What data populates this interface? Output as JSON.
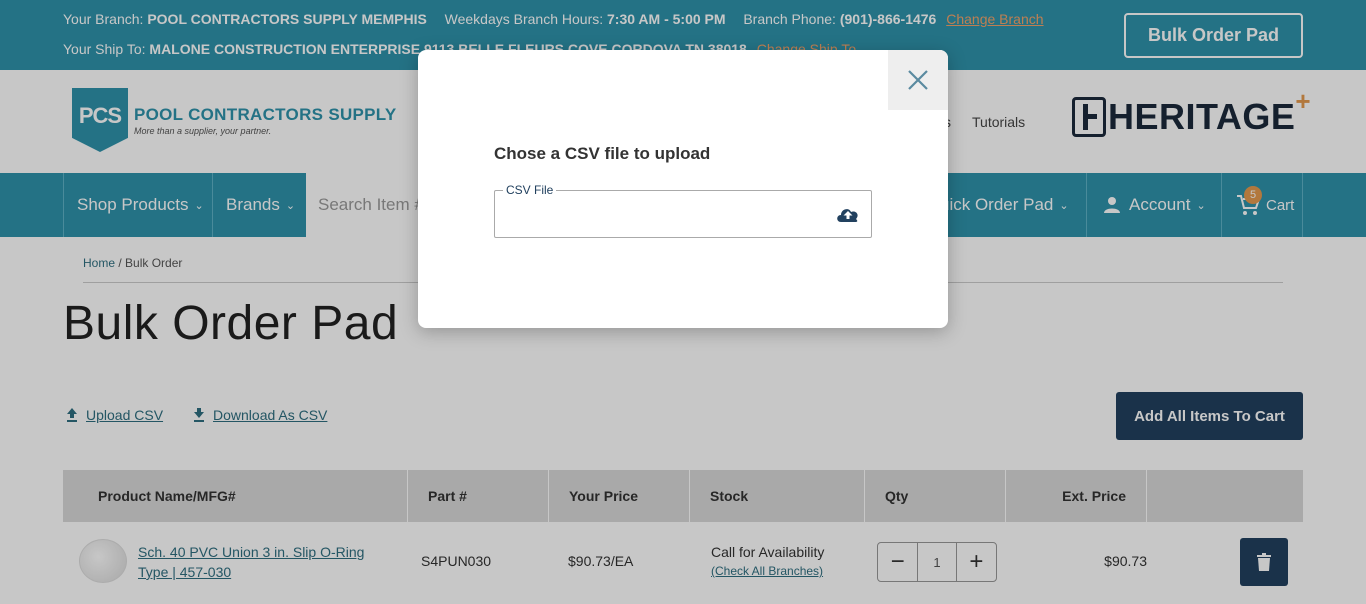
{
  "topbar": {
    "branch_label": "Your Branch:",
    "branch_name": "POOL CONTRACTORS SUPPLY MEMPHIS",
    "hours_label": "Weekdays Branch Hours:",
    "hours": "7:30 AM - 5:00 PM",
    "phone_label": "Branch Phone:",
    "phone": "(901)-866-1476",
    "change_branch": "Change Branch",
    "shipto_label": "Your Ship To:",
    "shipto": "MALONE CONSTRUCTION ENTERPRISE,9113 BELLE FLEURS COVE CORDOVA TN 38018",
    "change_shipto": "Change Ship To",
    "bulk_order_pad": "Bulk Order Pad"
  },
  "header": {
    "logo_mark": "PCS",
    "logo_name": "POOL CONTRACTORS SUPPLY",
    "logo_tagline": "More than a supplier, your partner.",
    "nav_partial": "s",
    "tutorials": "Tutorials",
    "heritage": "HERITAGE",
    "heritage_plus": "+"
  },
  "mainnav": {
    "shop_products": "Shop Products",
    "brands": "Brands",
    "search_placeholder": "Search Item #",
    "quick_order": "uick Order Pad",
    "account": "Account",
    "cart": "Cart",
    "cart_count": "5"
  },
  "breadcrumb": {
    "home": "Home",
    "sep": "/",
    "current": "Bulk Order"
  },
  "page": {
    "title": "Bulk Order Pad",
    "upload_csv": "Upload CSV",
    "download_csv": "Download As CSV",
    "add_all": "Add All Items To Cart"
  },
  "table": {
    "headers": [
      "Product Name/MFG#",
      "Part #",
      "Your Price",
      "Stock",
      "Qty",
      "Ext. Price"
    ],
    "rows": [
      {
        "name": "Sch. 40 PVC Union 3 in. Slip O-Ring Type | 457-030",
        "part": "S4PUN030",
        "price": "$90.73/EA",
        "stock": "Call for Availability",
        "stock_link": "(Check All Branches)",
        "qty": "1",
        "ext": "$90.73"
      }
    ]
  },
  "modal": {
    "title": "Chose a CSV file to upload",
    "field_label": "CSV File"
  },
  "colors": {
    "brand_teal": "#2f93ab",
    "navy": "#22415f",
    "accent_orange": "#e49a4f"
  }
}
